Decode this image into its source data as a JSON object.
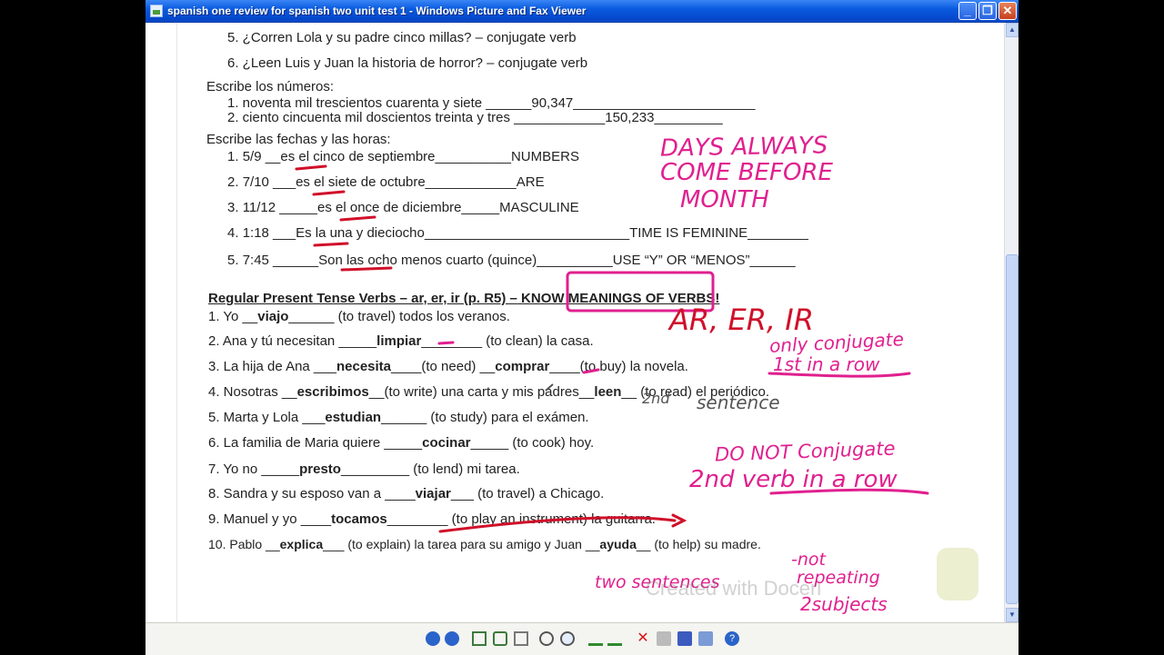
{
  "window": {
    "title": "spanish one review for spanish two unit test 1 - Windows Picture and Fax Viewer"
  },
  "buttons": {
    "minimize": "_",
    "maximize": "❐",
    "close": "✕"
  },
  "doc": {
    "q5": "5.  ¿Corren Lola y su padre cinco millas? – conjugate verb",
    "q6": "6.  ¿Leen Luis y Juan la historia de horror? – conjugate verb",
    "numbers_heading": "Escribe los números:",
    "n1_text": "1.  noventa mil trescientos cuarenta y siete ______",
    "n1_answer": "90,347",
    "n2_text": "2.  ciento cincuenta mil doscientos treinta y tres ____________",
    "n2_answer": "150,233",
    "dates_heading": "Escribe las fechas y las horas:",
    "d1": {
      "num": "1.",
      "date": "5/9 __",
      "ans": "es el",
      "rest": " cinco de septiembre__________",
      "note": "NUMBERS"
    },
    "d2": {
      "num": "2.",
      "date": "7/10 ___",
      "ans": "es el",
      "rest": " siete de octubre____________",
      "note": "ARE"
    },
    "d3": {
      "num": "3.",
      "date": "11/12 _____",
      "ans": "es el",
      "rest": " once de diciembre_____",
      "note": "MASCULINE"
    },
    "d4": {
      "num": "4.",
      "date": "1:18 ___",
      "ans": "Es la",
      "rest": " una y dieciocho___________________________",
      "note": "TIME IS FEMININE________"
    },
    "d5": {
      "num": "5.",
      "date": "7:45 ______",
      "ans": "Son las",
      "rest": " ocho menos cuarto (quince)__________",
      "note": "USE “Y” OR “MENOS”______"
    },
    "verbs_heading": "Regular Present Tense Verbs – ar, er, ir (p. R5) –",
    "verbs_heading_box": "KNOW MEANINGS",
    "verbs_heading_end": " OF VERBS!",
    "v1": {
      "a": "1. Yo __",
      "b": "viajo",
      "c": "______ (to travel) todos los veranos."
    },
    "v2": {
      "a": "2. Ana y tú necesitan _____",
      "b": "limpiar",
      "c": "________ (to clean) la casa."
    },
    "v3": {
      "a": "3. La hija de Ana ___",
      "b": "necesita",
      "c": "____(to need) __",
      "d": "comprar",
      "e": "____(to buy) la novela."
    },
    "v4": {
      "a": "4. Nosotras __",
      "b": "escribimos",
      "c": "__(to write) una carta y mis padres__",
      "d": "leen",
      "e": "__ (to read) el periódico."
    },
    "v5": {
      "a": "5. Marta y Lola ___",
      "b": "estudian",
      "c": "______ (to study) para el exámen."
    },
    "v6": {
      "a": "6. La familia de Maria quiere _____",
      "b": "cocinar",
      "c": "_____ (to cook) hoy."
    },
    "v7": {
      "a": "7. Yo no _____",
      "b": "presto",
      "c": "_________ (to lend) mi tarea."
    },
    "v8": {
      "a": "8. Sandra y su esposo van a ____",
      "b": "viajar",
      "c": "___ (to travel) a Chicago."
    },
    "v9": {
      "a": "9. Manuel y yo ____",
      "b": "tocamos",
      "c": "________ (to play an instrument) la guitarra."
    },
    "v10": {
      "a": "10. Pablo __",
      "b": "explica",
      "c": "___ (to explain) la tarea para su amigo y Juan __",
      "d": "ayuda",
      "e": "__ (to help) su madre."
    }
  },
  "annotations": {
    "days1": "DAYS ALWAYS",
    "days2": "COME BEFORE",
    "days3": "MONTH",
    "arerir": "AR, ER, IR",
    "only1": "only conjugate",
    "only2": "1st in a row",
    "second1": "2nd",
    "second2": "sentence",
    "donot1": "DO NOT Conjugate",
    "donot2": "2nd verb in a row",
    "two_sent": "two sentences",
    "not_rep1": "-not",
    "not_rep2": "repeating",
    "two_subj": "2subjects",
    "watermark": "Created with Doceri"
  },
  "colors": {
    "pink": "#e0208f",
    "red": "#d0102a",
    "titlebar": "#0a5be0"
  },
  "toolbar_icons": [
    "prev-image-icon",
    "next-image-icon",
    "best-fit-icon",
    "actual-size-icon",
    "slideshow-icon",
    "zoom-in-icon",
    "zoom-out-icon",
    "rotate-clockwise-icon",
    "rotate-counterclockwise-icon",
    "delete-icon",
    "print-icon",
    "save-icon",
    "open-editor-icon",
    "help-icon"
  ]
}
